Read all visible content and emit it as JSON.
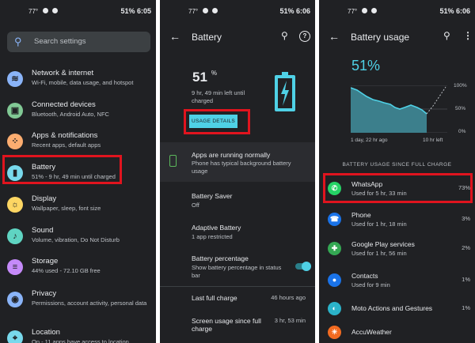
{
  "panel1": {
    "status": {
      "left": "77°",
      "time": "51% 6:05"
    },
    "search_placeholder": "Search settings",
    "items": [
      {
        "title": "Network & internet",
        "sub": "Wi-Fi, mobile, data usage, and hotspot",
        "icon": "wifi-icon",
        "color": "#8ab4f8"
      },
      {
        "title": "Connected devices",
        "sub": "Bluetooth, Android Auto, NFC",
        "icon": "devices-icon",
        "color": "#81c995"
      },
      {
        "title": "Apps & notifications",
        "sub": "Recent apps, default apps",
        "icon": "apps-icon",
        "color": "#fcad70"
      },
      {
        "title": "Battery",
        "sub": "51% - 9 hr, 49 min until charged",
        "icon": "battery-icon",
        "color": "#78d9ec"
      },
      {
        "title": "Display",
        "sub": "Wallpaper, sleep, font size",
        "icon": "display-icon",
        "color": "#fdd663"
      },
      {
        "title": "Sound",
        "sub": "Volume, vibration, Do Not Disturb",
        "icon": "sound-icon",
        "color": "#5fd4c2"
      },
      {
        "title": "Storage",
        "sub": "44% used - 72.10 GB free",
        "icon": "storage-icon",
        "color": "#c58af9"
      },
      {
        "title": "Privacy",
        "sub": "Permissions, account activity, personal data",
        "icon": "privacy-icon",
        "color": "#8ab4f8"
      },
      {
        "title": "Location",
        "sub": "On - 11 apps have access to location",
        "icon": "location-icon",
        "color": "#78d9ec"
      }
    ]
  },
  "panel2": {
    "status": {
      "left": "77°",
      "time": "51% 6:06"
    },
    "title": "Battery",
    "percent": "51",
    "percent_unit": "%",
    "time_left": "9 hr, 49 min left until charged",
    "usage_button": "USAGE DETAILS",
    "card_title": "Apps are running normally",
    "card_sub": "Phone has typical background battery usage",
    "rows": [
      {
        "title": "Battery Saver",
        "sub": "Off",
        "value": ""
      },
      {
        "title": "Adaptive Battery",
        "sub": "1 app restricted",
        "value": ""
      },
      {
        "title": "Battery percentage",
        "sub": "Show battery percentage in status bar",
        "value": ""
      },
      {
        "title": "Last full charge",
        "sub": "",
        "value": "46 hours ago"
      },
      {
        "title": "Screen usage since full charge",
        "sub": "",
        "value": "3 hr, 53 min"
      }
    ],
    "battery_percentage_enabled": true,
    "accent": "#4fd1e6"
  },
  "panel3": {
    "status": {
      "left": "77°",
      "time": "51% 6:06"
    },
    "title": "Battery usage",
    "percent": "51%",
    "chart_y_labels": [
      "100%",
      "50%",
      "0%"
    ],
    "chart_x_start": "1 day, 22 hr ago",
    "chart_x_end": "10 hr left",
    "section": "BATTERY USAGE SINCE FULL CHARGE",
    "apps": [
      {
        "name": "WhatsApp",
        "used": "Used for 5 hr, 33 min",
        "pct": "73%",
        "icon": "whatsapp-icon",
        "color": "#25d366"
      },
      {
        "name": "Phone",
        "used": "Used for 1 hr, 18 min",
        "pct": "3%",
        "icon": "phone-icon",
        "color": "#1a73e8"
      },
      {
        "name": "Google Play services",
        "used": "Used for 1 hr, 56 min",
        "pct": "2%",
        "icon": "puzzle-icon",
        "color": "#34a853"
      },
      {
        "name": "Contacts",
        "used": "Used for 9 min",
        "pct": "1%",
        "icon": "contacts-icon",
        "color": "#1a73e8"
      },
      {
        "name": "Moto Actions and Gestures",
        "used": "",
        "pct": "1%",
        "icon": "moto-icon",
        "color": "#2bb3c9"
      },
      {
        "name": "AccuWeather",
        "used": "",
        "pct": "",
        "icon": "weather-icon",
        "color": "#f26b21"
      }
    ]
  }
}
